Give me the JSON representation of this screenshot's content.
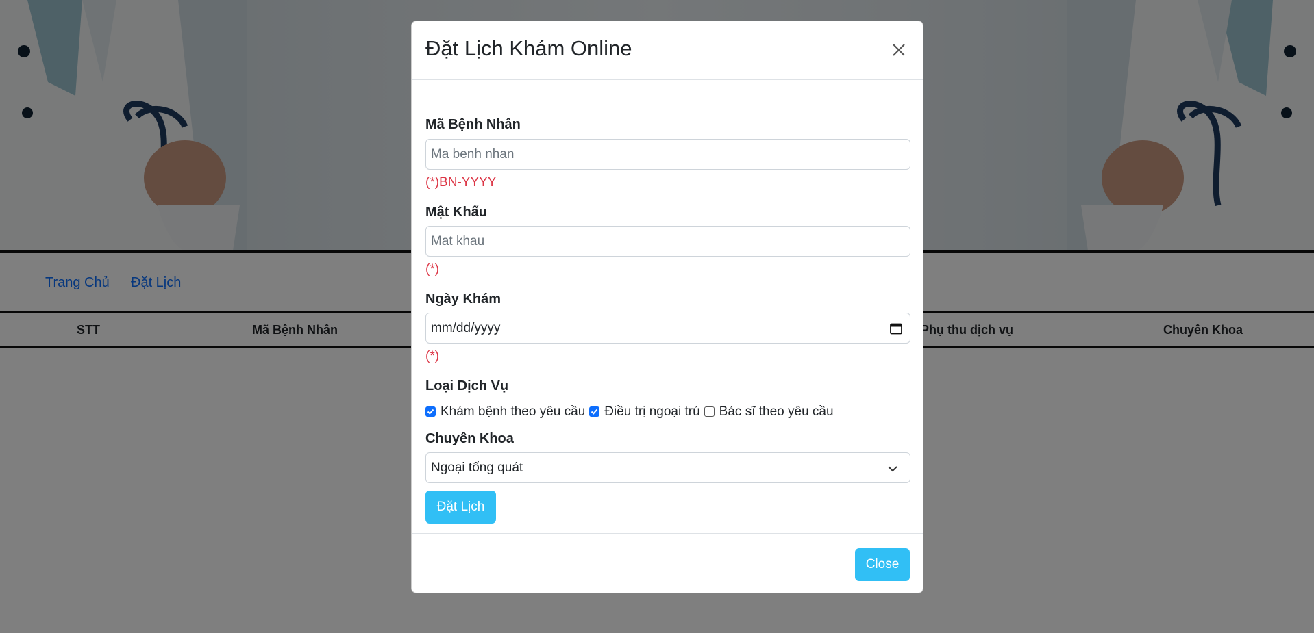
{
  "nav": {
    "home": "Trang Chủ",
    "booking": "Đặt Lịch"
  },
  "table": {
    "headers": [
      "STT",
      "Mã Bệnh Nhân",
      "Phụ thu dịch vụ",
      "Chuyên Khoa"
    ]
  },
  "modal": {
    "title": "Đặt Lịch Khám Online",
    "patient_id": {
      "label": "Mã Bệnh Nhân",
      "placeholder": "Ma benh nhan",
      "hint": "(*)BN-YYYY"
    },
    "password": {
      "label": "Mật Khẩu",
      "placeholder": "Mat khau",
      "hint": "(*)"
    },
    "date": {
      "label": "Ngày Khám",
      "value": "mm/dd/yyyy",
      "hint": "(*)"
    },
    "service": {
      "label": "Loại Dịch Vụ",
      "options": [
        {
          "label": "Khám bệnh theo yêu cầu",
          "checked": true
        },
        {
          "label": "Điều trị ngoại trú",
          "checked": true
        },
        {
          "label": "Bác sĩ theo yêu cầu",
          "checked": false
        }
      ]
    },
    "specialty": {
      "label": "Chuyên Khoa",
      "selected": "Ngoại tổng quát"
    },
    "submit_label": "Đặt Lịch",
    "close_label": "Close"
  },
  "colors": {
    "accent": "#31bff5",
    "link": "#0d6efd",
    "error": "#dc3545",
    "checkbox": "#0d6efd"
  },
  "icons": {
    "close": "close-icon",
    "calendar": "calendar-icon",
    "dropdown": "chevron-down-icon"
  }
}
